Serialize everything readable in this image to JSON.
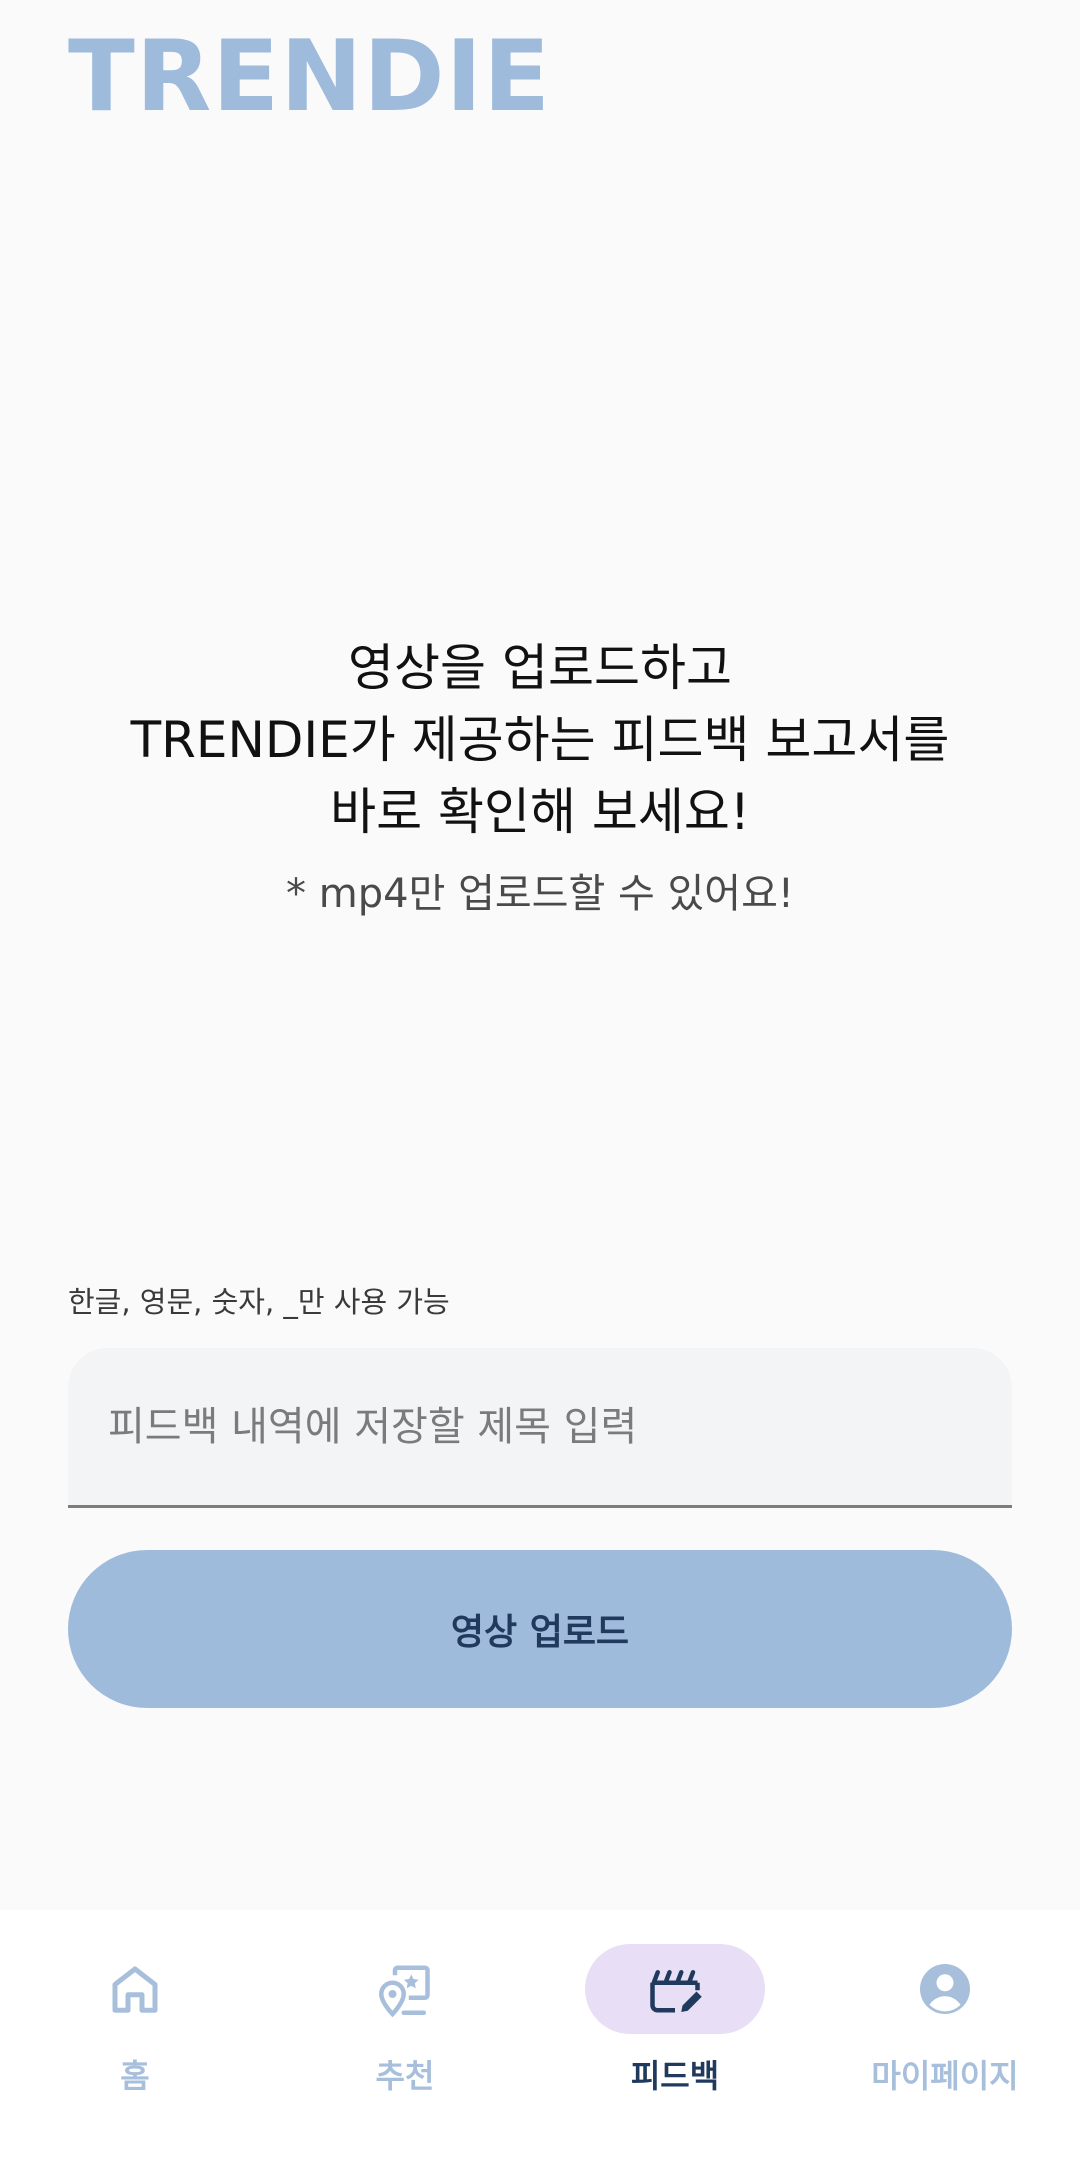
{
  "app": {
    "logo_text": "TRENDIE"
  },
  "intro": {
    "lines": [
      "영상을 업로드하고",
      "TRENDIE가 제공하는 피드백 보고서를",
      "바로 확인해 보세요!"
    ],
    "note": "* mp4만 업로드할 수 있어요!"
  },
  "form": {
    "helper_text": "한글, 영문, 숫자, _만 사용 가능",
    "title_value": "",
    "title_placeholder": "피드백 내역에 저장할 제목 입력",
    "upload_label": "영상 업로드"
  },
  "bottom_nav": {
    "items": [
      {
        "label": "홈",
        "icon": "home-icon",
        "active": false
      },
      {
        "label": "추천",
        "icon": "recommend-icon",
        "active": false
      },
      {
        "label": "피드백",
        "icon": "clapperboard-edit-icon",
        "active": true
      },
      {
        "label": "마이페이지",
        "icon": "account-circle-icon",
        "active": false
      }
    ]
  },
  "colors": {
    "accent": "#9fbbdb",
    "accent_dark": "#1f3a5c",
    "active_pill": "#e8def5",
    "background": "#fafafb",
    "inactive_nav": "#a7bfdb"
  }
}
